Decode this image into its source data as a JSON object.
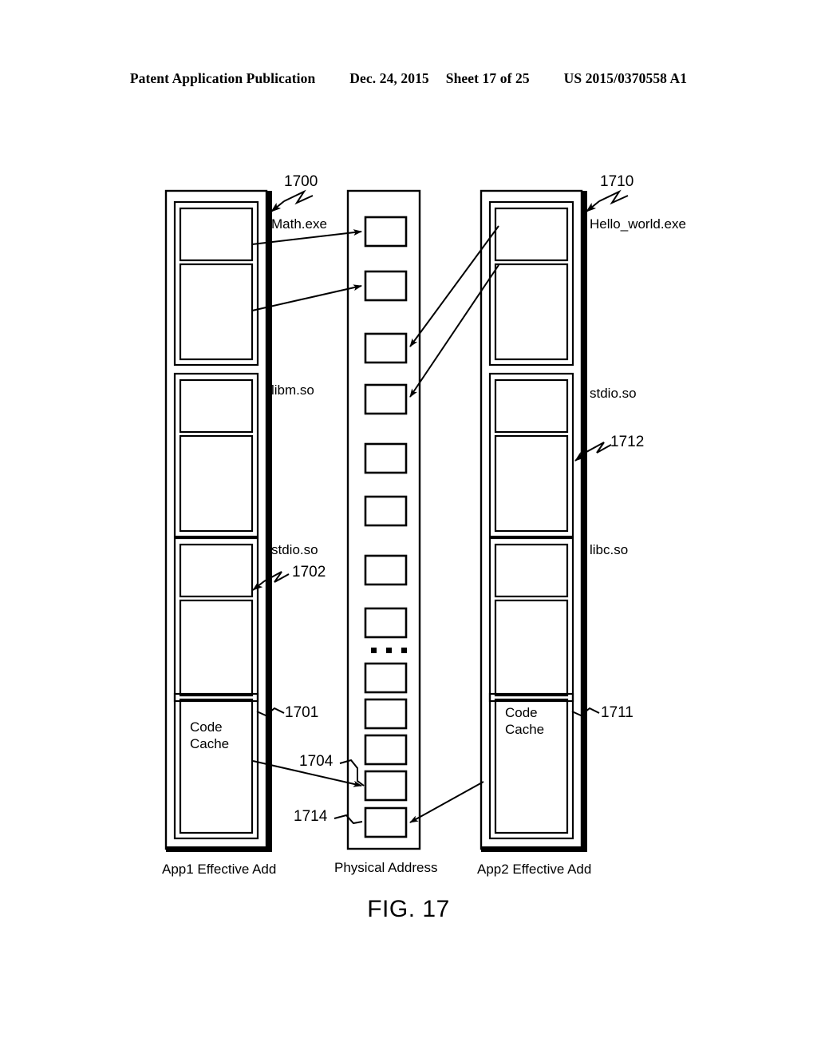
{
  "header": {
    "publication": "Patent Application Publication",
    "date": "Dec. 24, 2015",
    "sheet": "Sheet 17 of 25",
    "number": "US 2015/0370558 A1"
  },
  "figure": {
    "caption": "FIG. 17",
    "columns": [
      {
        "id": "app1",
        "caption": "App1 Effective Add"
      },
      {
        "id": "physical",
        "caption": "Physical Address"
      },
      {
        "id": "app2",
        "caption": "App2 Effective Add"
      }
    ]
  },
  "left_column": {
    "caption": "App1 Effective Add",
    "module_labels": [
      "Math.exe",
      "libm.so",
      "stdio.so"
    ],
    "code_cache_label": "Code\nCache",
    "code_cache_line1": "Code",
    "code_cache_line2": "Cache",
    "ref_top": "1700",
    "ref_module": "1702",
    "ref_code_cache": "1701"
  },
  "middle_column": {
    "caption": "Physical Address",
    "ellipsis": ". . .",
    "ref_page_app1": "1704",
    "ref_page_app2": "1714",
    "page_count": 13
  },
  "right_column": {
    "caption": "App2 Effective Add",
    "module_labels": [
      "Hello_world.exe",
      "stdio.so",
      "libc.so"
    ],
    "code_cache_line1": "Code",
    "code_cache_line2": "Cache",
    "ref_top": "1710",
    "ref_module": "1712",
    "ref_code_cache": "1711"
  },
  "colors": {
    "stroke": "#000000",
    "background": "#ffffff"
  }
}
